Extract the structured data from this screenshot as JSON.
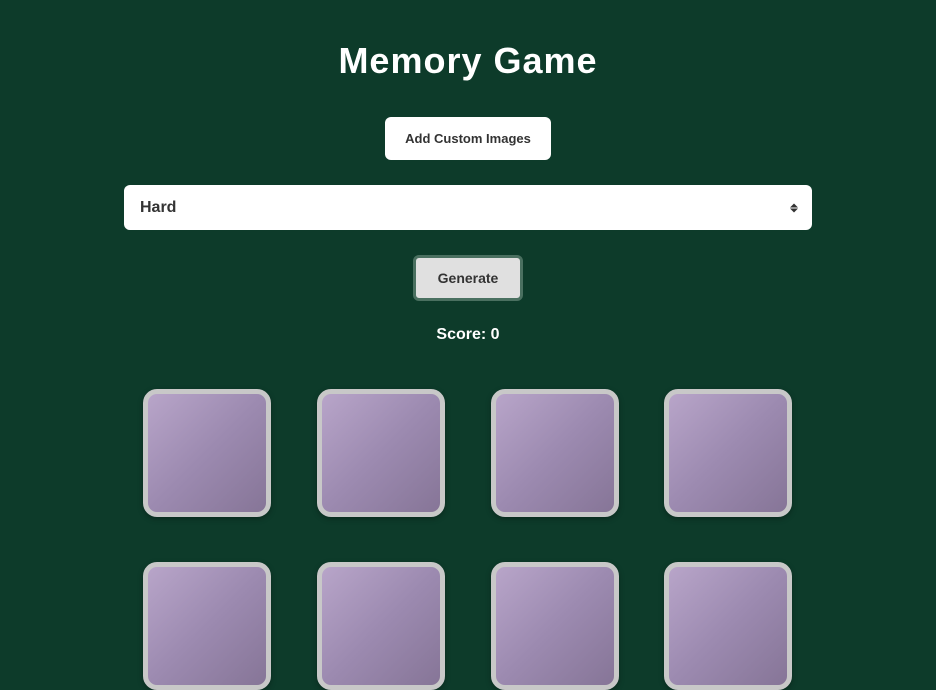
{
  "title": "Memory Game",
  "addImagesLabel": "Add Custom Images",
  "difficulty": {
    "selected": "Hard"
  },
  "generateLabel": "Generate",
  "scoreLabel": "Score: ",
  "scoreValue": "0",
  "cards": {
    "count": 8
  }
}
